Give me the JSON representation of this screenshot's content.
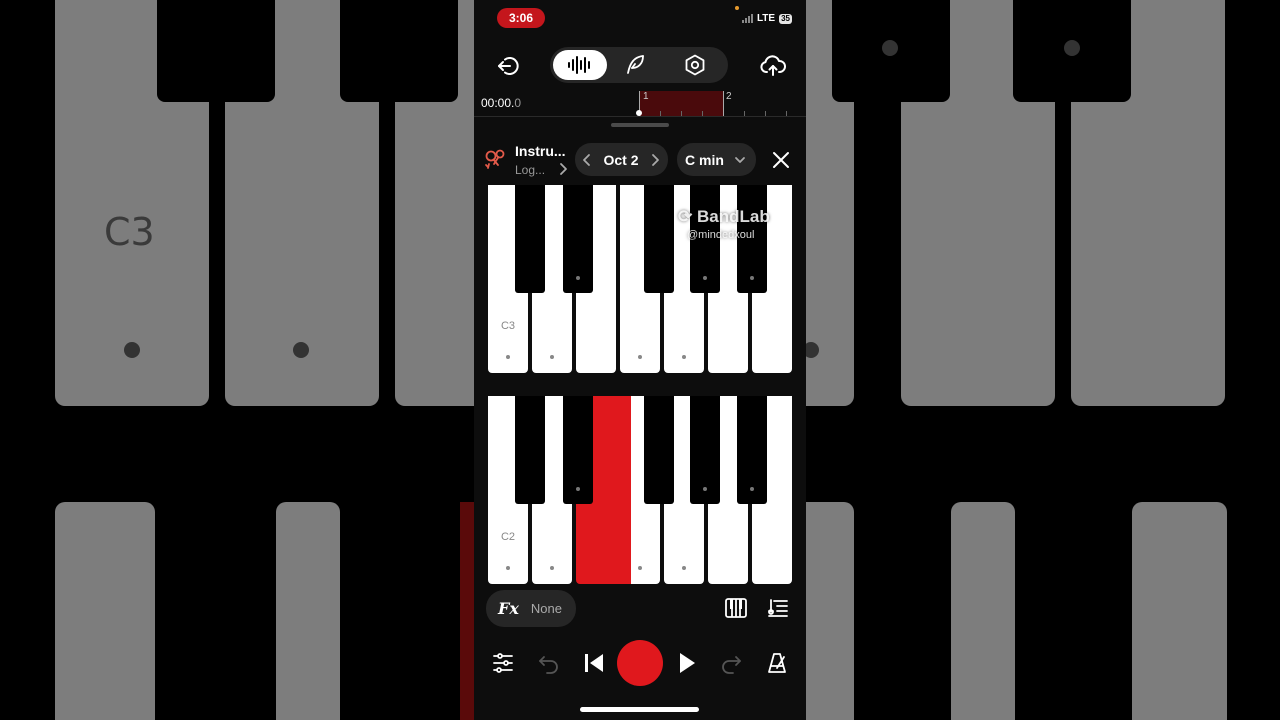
{
  "status_bar": {
    "time": "3:06",
    "network": "LTE",
    "battery": "35"
  },
  "header": {
    "back_icon": "exit-icon",
    "modes": [
      "waveform-icon",
      "quill-icon",
      "hexagon-settings-icon"
    ],
    "upload_icon": "cloud-upload-icon"
  },
  "timeline": {
    "timecode_main": "00:00.",
    "timecode_frac": "0",
    "bar_markers": [
      "1",
      "2"
    ]
  },
  "instrument": {
    "title": "Instru...",
    "subtitle": "Log...",
    "octave": "Oct 2",
    "key": "C min"
  },
  "watermark": {
    "brand": "BandLab",
    "handle": "@mindedxoul"
  },
  "keyboard": {
    "upper_label": "C3",
    "lower_label": "C2",
    "pressed_key": "D2"
  },
  "fx": {
    "label": "Fx",
    "value": "None"
  },
  "background": {
    "label": "C3"
  },
  "colors": {
    "accent": "#e0181d",
    "panel": "#262626",
    "background": "#0d0d0d"
  }
}
